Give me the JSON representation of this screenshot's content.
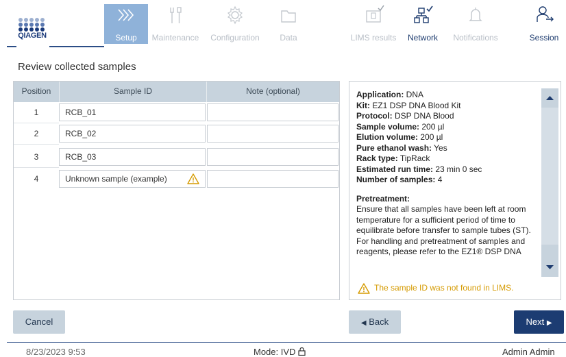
{
  "brand": {
    "logo_text": "QIAGEN"
  },
  "nav": {
    "setup": "Setup",
    "maintenance": "Maintenance",
    "configuration": "Configuration",
    "data": "Data",
    "lims_results": "LIMS results",
    "network": "Network",
    "notifications": "Notifications",
    "session": "Session"
  },
  "page": {
    "title": "Review collected samples"
  },
  "table": {
    "headers": {
      "position": "Position",
      "sample_id": "Sample ID",
      "note": "Note (optional)"
    },
    "rows": [
      {
        "position": "1",
        "sample_id": "RCB_01",
        "note": ""
      },
      {
        "position": "2",
        "sample_id": "RCB_02",
        "note": ""
      },
      {
        "position": "3",
        "sample_id": "RCB_03",
        "note": ""
      },
      {
        "position": "4",
        "sample_id": "Unknown sample (example)",
        "note": ""
      }
    ]
  },
  "info": {
    "application_label": "Application:",
    "application": "DNA",
    "kit_label": "Kit:",
    "kit": "EZ1 DSP DNA Blood Kit",
    "protocol_label": "Protocol:",
    "protocol": "DSP DNA Blood",
    "sample_volume_label": "Sample volume:",
    "sample_volume": "200 µl",
    "elution_volume_label": "Elution volume:",
    "elution_volume": "200 µl",
    "ethanol_label": "Pure ethanol wash:",
    "ethanol": "Yes",
    "rack_label": "Rack type:",
    "rack": "TipRack",
    "runtime_label": "Estimated run time:",
    "runtime": "23 min 0 sec",
    "num_samples_label": "Number of samples:",
    "num_samples": "4",
    "pretreatment_label": "Pretreatment:",
    "pretreatment_text": "Ensure that all samples have been left at room temperature for a sufficient period of time to equilibrate before transfer to sample tubes (ST).",
    "handling_text": "For handling and pretreatment of samples and reagents, please refer to the EZ1® DSP DNA",
    "lims_warning": "The sample ID was not found in LIMS."
  },
  "buttons": {
    "cancel": "Cancel",
    "back": "Back",
    "next": "Next"
  },
  "footer": {
    "datetime": "8/23/2023 9:53",
    "mode": "Mode: IVD",
    "user": "Admin Admin"
  },
  "colors": {
    "accent": "#1c3c72",
    "nav_active": "#8fb2d9",
    "warning": "#d59a00",
    "panel": "#c7d3dd"
  }
}
